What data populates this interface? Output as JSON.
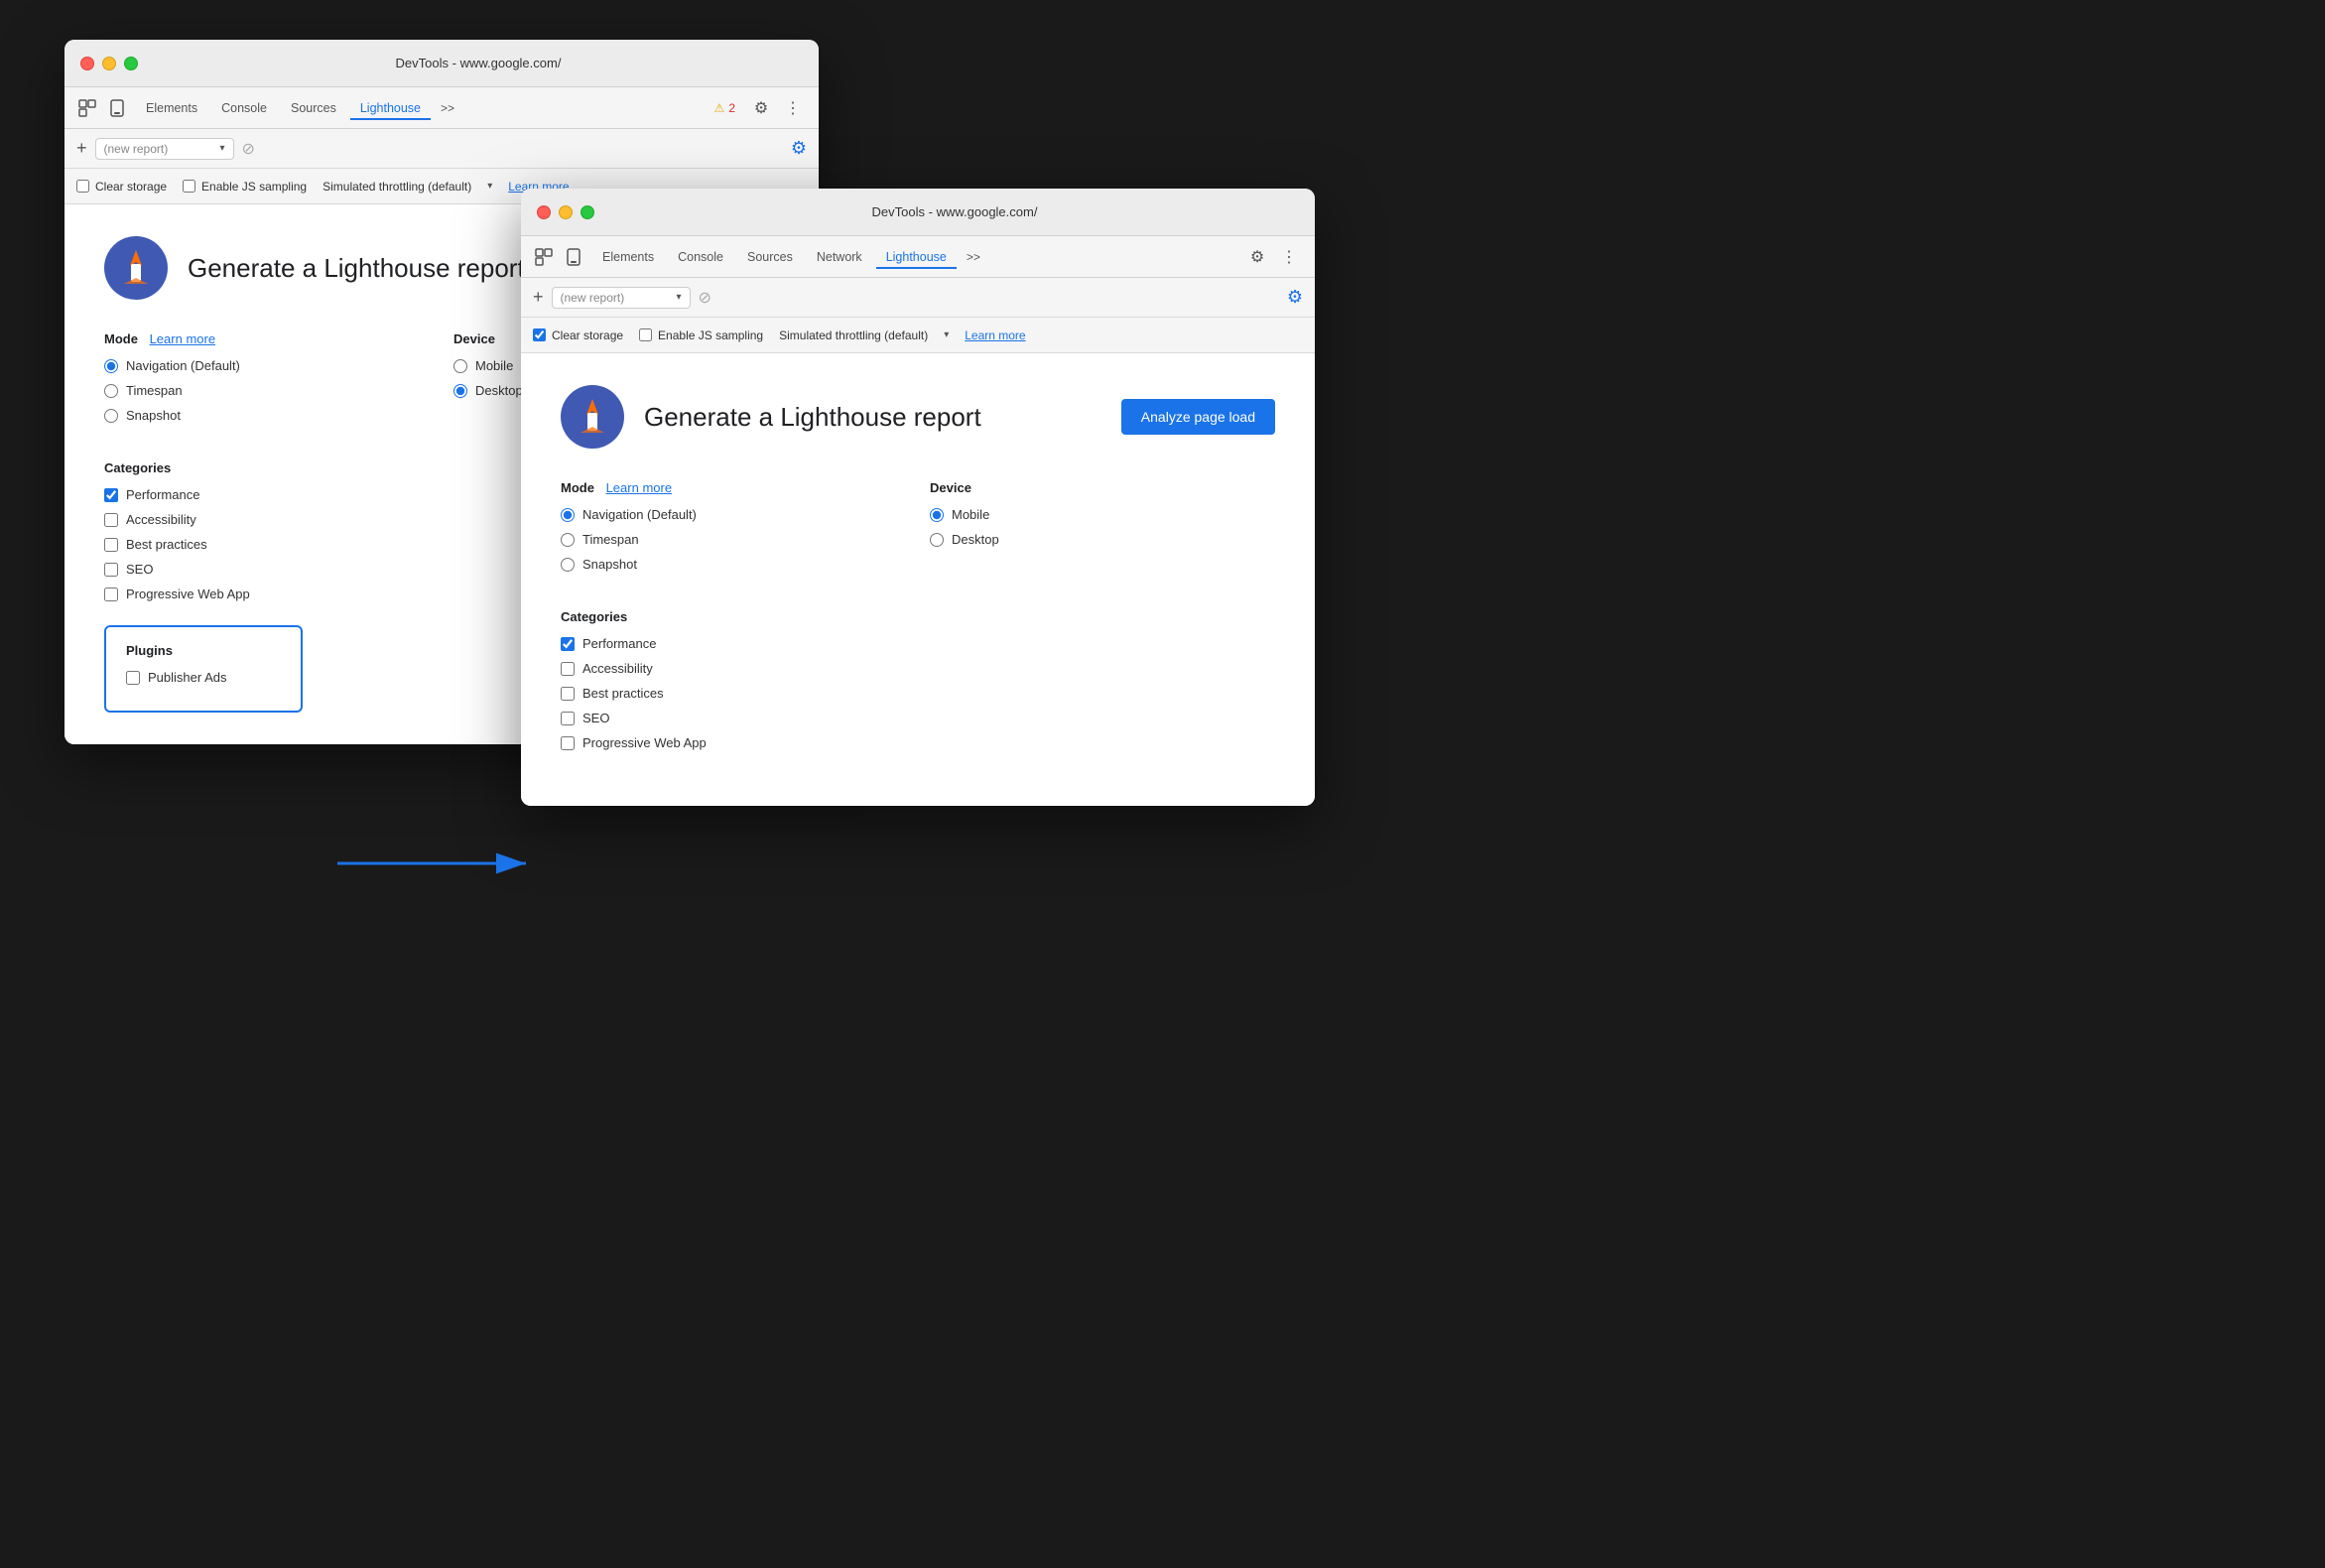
{
  "window1": {
    "title": "DevTools - www.google.com/",
    "traffic_lights": [
      "red",
      "yellow",
      "green"
    ],
    "tabs": [
      {
        "label": "Elements",
        "active": false
      },
      {
        "label": "Console",
        "active": false
      },
      {
        "label": "Sources",
        "active": false
      },
      {
        "label": "Lighthouse",
        "active": true
      }
    ],
    "tab_more": ">>",
    "warning_count": "2",
    "new_report_placeholder": "(new report)",
    "toolbar_gear_title": "Settings",
    "options": {
      "clear_storage": {
        "label": "Clear storage",
        "checked": false
      },
      "enable_js_sampling": {
        "label": "Enable JS sampling",
        "checked": false
      },
      "simulated_throttling": {
        "label": "Simulated throttling (default)"
      },
      "learn_more": "Learn more"
    },
    "panel": {
      "report_title": "Generate a Lighthouse report",
      "mode_label": "Mode",
      "learn_more": "Learn more",
      "device_label": "Device",
      "mode_options": [
        {
          "label": "Navigation (Default)",
          "checked": true
        },
        {
          "label": "Timespan",
          "checked": false
        },
        {
          "label": "Snapshot",
          "checked": false
        }
      ],
      "device_options": [
        {
          "label": "Mobile",
          "checked": false
        },
        {
          "label": "Desktop",
          "checked": true
        }
      ],
      "categories_label": "Categories",
      "categories": [
        {
          "label": "Performance",
          "checked": true
        },
        {
          "label": "Accessibility",
          "checked": false
        },
        {
          "label": "Best practices",
          "checked": false
        },
        {
          "label": "SEO",
          "checked": false
        },
        {
          "label": "Progressive Web App",
          "checked": false
        }
      ],
      "plugins_label": "Plugins",
      "plugins": [
        {
          "label": "Publisher Ads",
          "checked": false
        }
      ]
    }
  },
  "window2": {
    "title": "DevTools - www.google.com/",
    "traffic_lights": [
      "red",
      "yellow",
      "green"
    ],
    "tabs": [
      {
        "label": "Elements",
        "active": false
      },
      {
        "label": "Console",
        "active": false
      },
      {
        "label": "Sources",
        "active": false
      },
      {
        "label": "Network",
        "active": false
      },
      {
        "label": "Lighthouse",
        "active": true
      }
    ],
    "tab_more": ">>",
    "new_report_placeholder": "(new report)",
    "options": {
      "clear_storage": {
        "label": "Clear storage",
        "checked": true
      },
      "enable_js_sampling": {
        "label": "Enable JS sampling",
        "checked": false
      },
      "simulated_throttling": {
        "label": "Simulated throttling (default)"
      },
      "learn_more": "Learn more"
    },
    "panel": {
      "report_title": "Generate a Lighthouse report",
      "analyze_btn": "Analyze page load",
      "mode_label": "Mode",
      "learn_more": "Learn more",
      "device_label": "Device",
      "mode_options": [
        {
          "label": "Navigation (Default)",
          "checked": true
        },
        {
          "label": "Timespan",
          "checked": false
        },
        {
          "label": "Snapshot",
          "checked": false
        }
      ],
      "device_options": [
        {
          "label": "Mobile",
          "checked": true
        },
        {
          "label": "Desktop",
          "checked": false
        }
      ],
      "categories_label": "Categories",
      "categories": [
        {
          "label": "Performance",
          "checked": true
        },
        {
          "label": "Accessibility",
          "checked": false
        },
        {
          "label": "Best practices",
          "checked": false
        },
        {
          "label": "SEO",
          "checked": false
        },
        {
          "label": "Progressive Web App",
          "checked": false
        }
      ]
    }
  }
}
